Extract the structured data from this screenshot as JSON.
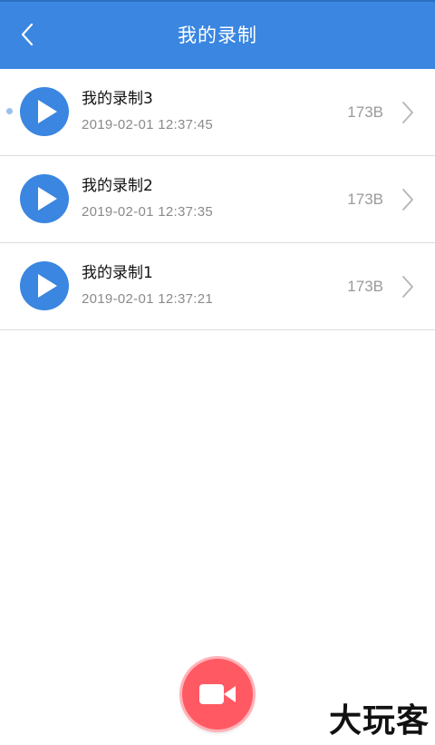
{
  "header": {
    "title": "我的录制"
  },
  "recordings": [
    {
      "name": "我的录制3",
      "datetime": "2019-02-01 12:37:45",
      "size": "173B",
      "unread": true
    },
    {
      "name": "我的录制2",
      "datetime": "2019-02-01 12:37:35",
      "size": "173B",
      "unread": false
    },
    {
      "name": "我的录制1",
      "datetime": "2019-02-01 12:37:21",
      "size": "173B",
      "unread": false
    }
  ],
  "icons": {
    "back": "chevron-left-icon",
    "play": "play-icon",
    "chevron": "chevron-right-icon",
    "record": "video-camera-icon"
  },
  "colors": {
    "primary": "#3a86e0",
    "record_button": "#ff5a64"
  },
  "watermark": "大玩客"
}
